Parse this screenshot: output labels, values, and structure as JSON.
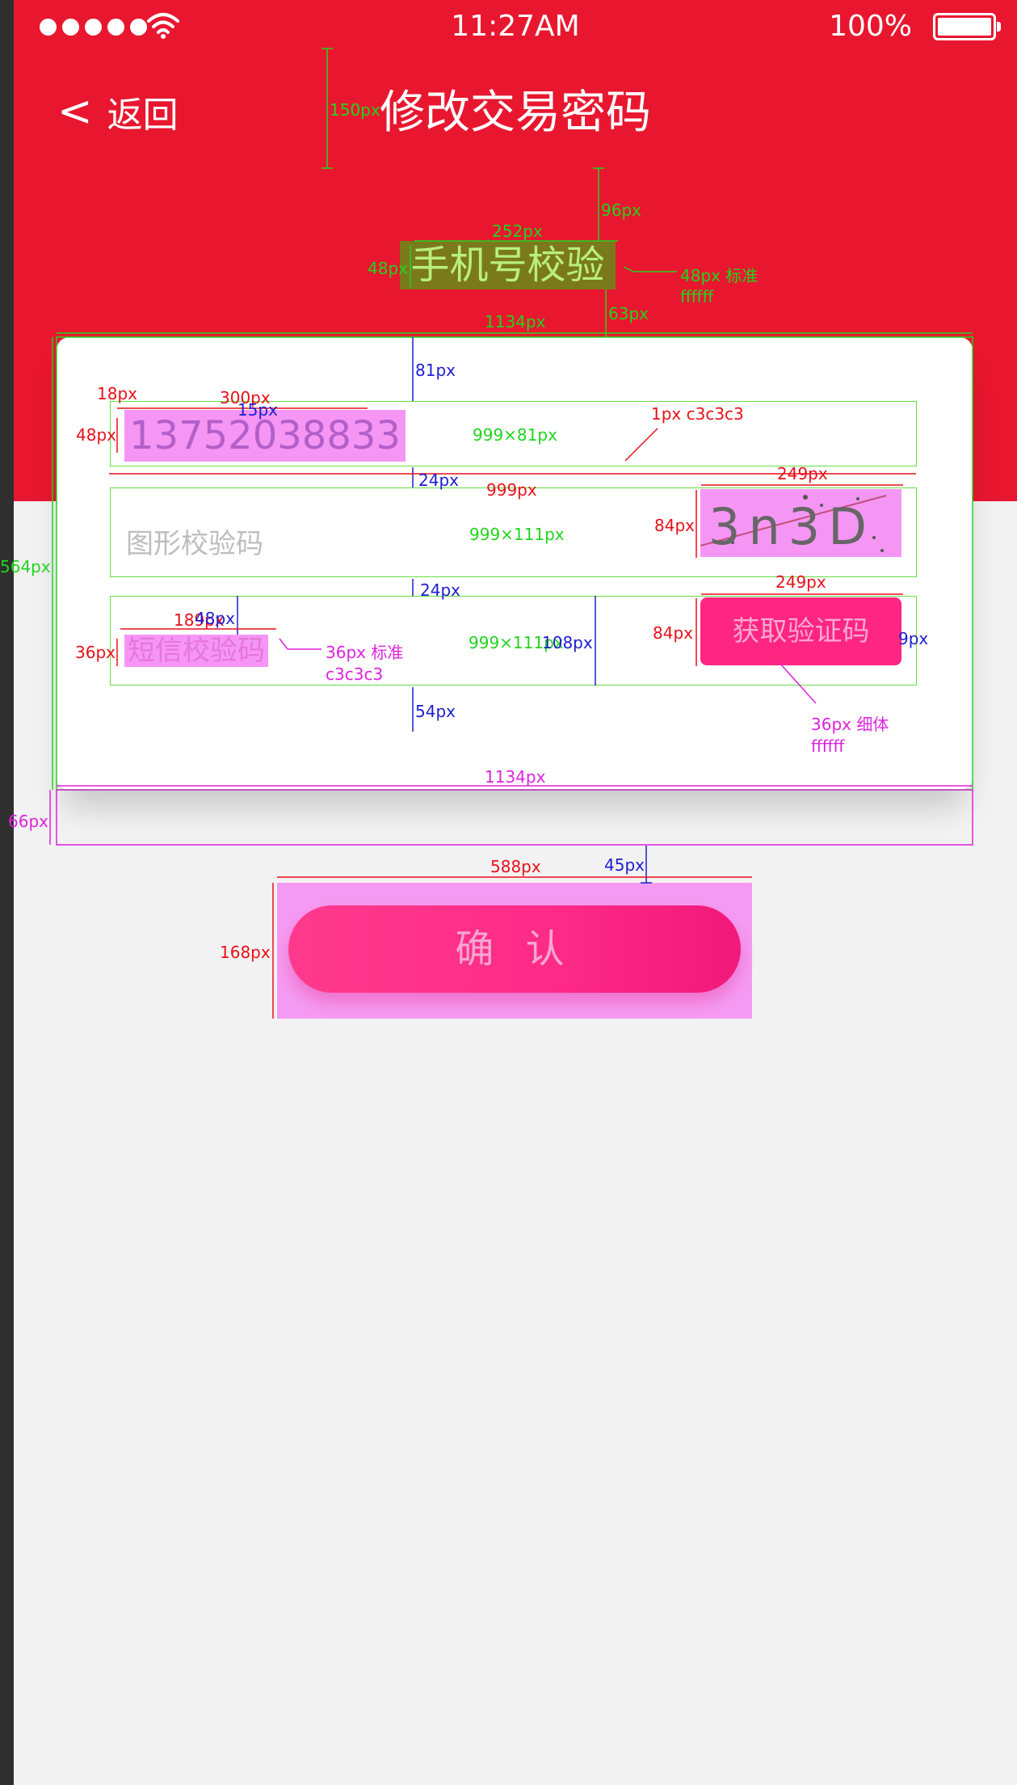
{
  "status_bar": {
    "time": "11:27AM",
    "battery": "100%"
  },
  "nav": {
    "back_label": "返回",
    "title": "修改交易密码"
  },
  "section": {
    "title": "手机号校验"
  },
  "form": {
    "phone_value": "13752038833",
    "image_code_placeholder": "图形校验码",
    "captcha_text": "3n3D",
    "sms_code_placeholder": "短信校验码",
    "sms_button_label": "获取验证码"
  },
  "confirm_label": "确 认",
  "colors": {
    "header_red": "#e8172f",
    "accent_pink": "#fe2681",
    "page_bg": "#f2f2f2",
    "card_bg": "#ffffff"
  },
  "annotations": [
    {
      "text": "150px",
      "color": "g"
    },
    {
      "text": "96px",
      "color": "g"
    },
    {
      "text": "252px",
      "color": "g"
    },
    {
      "text": "48px",
      "color": "g"
    },
    {
      "text": "48px 标准",
      "color": "g"
    },
    {
      "text": "ffffff",
      "color": "g"
    },
    {
      "text": "63px",
      "color": "g"
    },
    {
      "text": "1134px",
      "color": "g"
    },
    {
      "text": "81px",
      "color": "b"
    },
    {
      "text": "18px",
      "color": "r"
    },
    {
      "text": "300px",
      "color": "r"
    },
    {
      "text": "15px",
      "color": "b"
    },
    {
      "text": "48px",
      "color": "r"
    },
    {
      "text": "999×81px",
      "color": "g"
    },
    {
      "text": "1px c3c3c3",
      "color": "r"
    },
    {
      "text": "24px",
      "color": "b"
    },
    {
      "text": "999px",
      "color": "r"
    },
    {
      "text": "249px",
      "color": "r"
    },
    {
      "text": "564px",
      "color": "g"
    },
    {
      "text": "999×111px",
      "color": "g"
    },
    {
      "text": "84px",
      "color": "r"
    },
    {
      "text": "24px",
      "color": "b"
    },
    {
      "text": "249px",
      "color": "r"
    },
    {
      "text": "189px",
      "color": "r"
    },
    {
      "text": "48px",
      "color": "b"
    },
    {
      "text": "36px",
      "color": "r"
    },
    {
      "text": "36px 标准",
      "color": "m"
    },
    {
      "text": "c3c3c3",
      "color": "m"
    },
    {
      "text": "999×111px",
      "color": "g"
    },
    {
      "text": "108px",
      "color": "b"
    },
    {
      "text": "84px",
      "color": "r"
    },
    {
      "text": "9px",
      "color": "b"
    },
    {
      "text": "54px",
      "color": "b"
    },
    {
      "text": "36px 细体",
      "color": "m"
    },
    {
      "text": "ffffff",
      "color": "m"
    },
    {
      "text": "1134px",
      "color": "m"
    },
    {
      "text": "66px",
      "color": "m"
    },
    {
      "text": "588px",
      "color": "r"
    },
    {
      "text": "45px",
      "color": "b"
    },
    {
      "text": "168px",
      "color": "r"
    }
  ]
}
